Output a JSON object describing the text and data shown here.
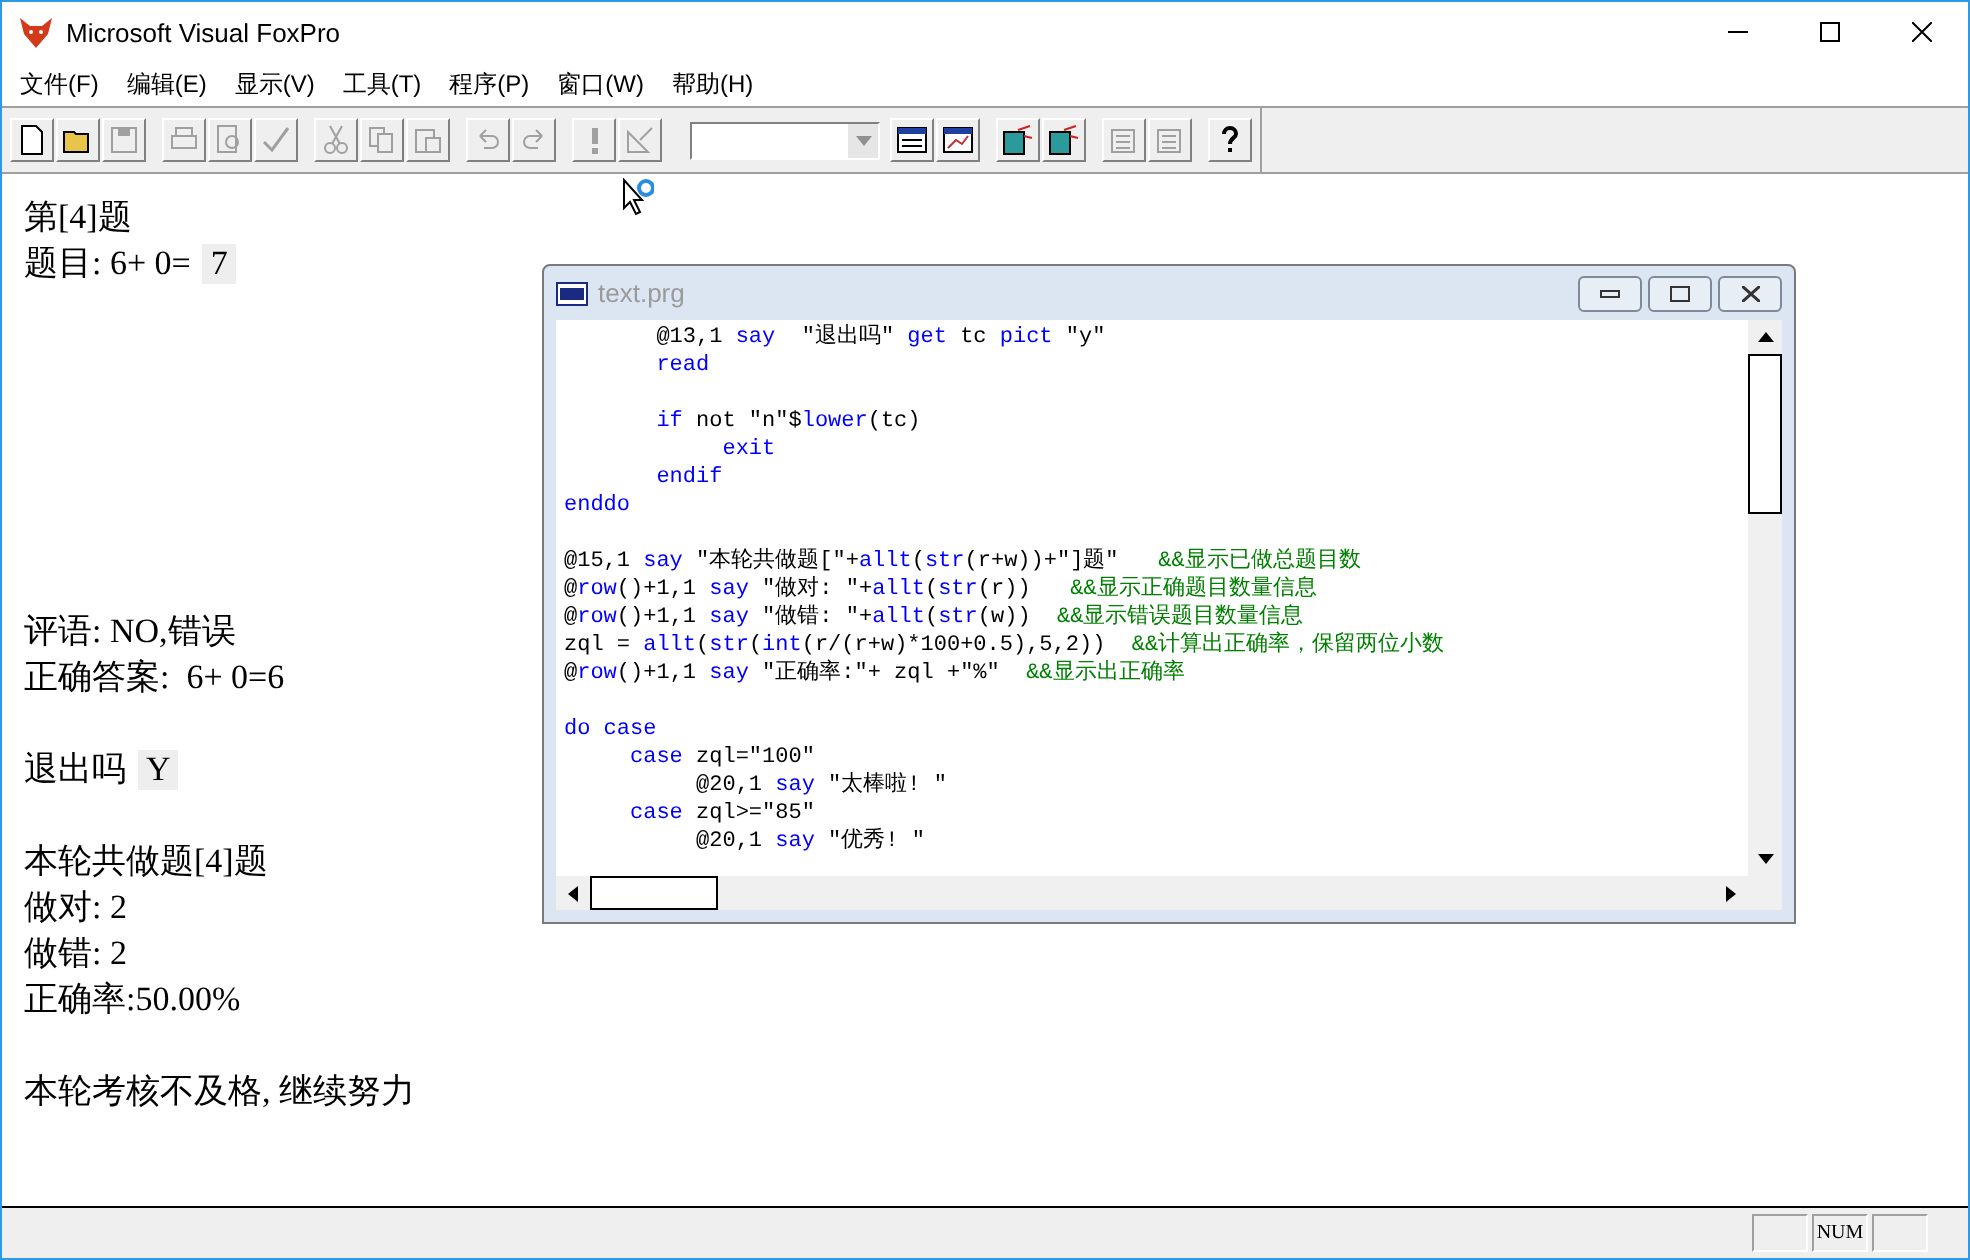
{
  "window": {
    "title": "Microsoft Visual FoxPro"
  },
  "menu": [
    "文件(F)",
    "编辑(E)",
    "显示(V)",
    "工具(T)",
    "程序(P)",
    "窗口(W)",
    "帮助(H)"
  ],
  "toolbar": [
    {
      "kind": "button",
      "disabled": false
    },
    {
      "kind": "button",
      "disabled": false
    },
    {
      "kind": "button",
      "disabled": true
    },
    {
      "kind": "separator"
    },
    {
      "kind": "button",
      "disabled": true
    },
    {
      "kind": "button",
      "disabled": true
    },
    {
      "kind": "button",
      "disabled": true
    },
    {
      "kind": "separator"
    },
    {
      "kind": "button",
      "disabled": true
    },
    {
      "kind": "button",
      "disabled": true
    },
    {
      "kind": "button",
      "disabled": true
    },
    {
      "kind": "separator"
    },
    {
      "kind": "button",
      "disabled": true
    },
    {
      "kind": "button",
      "disabled": true
    },
    {
      "kind": "separator"
    },
    {
      "kind": "button",
      "disabled": true
    },
    {
      "kind": "button",
      "disabled": true
    },
    {
      "kind": "separator"
    },
    {
      "kind": "combo"
    },
    {
      "kind": "button",
      "disabled": false
    },
    {
      "kind": "button",
      "disabled": false
    },
    {
      "kind": "separator"
    },
    {
      "kind": "button",
      "disabled": false
    },
    {
      "kind": "button",
      "disabled": false
    },
    {
      "kind": "separator"
    },
    {
      "kind": "button",
      "disabled": true
    },
    {
      "kind": "button",
      "disabled": true
    },
    {
      "kind": "separator"
    },
    {
      "kind": "button",
      "disabled": false
    }
  ],
  "output": [
    {
      "kind": "text",
      "text": "第[4]题"
    },
    {
      "kind": "text",
      "text": "题目: 6+ 0=",
      "input": "7"
    },
    {
      "kind": "blank"
    },
    {
      "kind": "blank"
    },
    {
      "kind": "blank"
    },
    {
      "kind": "blank"
    },
    {
      "kind": "blank"
    },
    {
      "kind": "blank"
    },
    {
      "kind": "blank"
    },
    {
      "kind": "text",
      "text": "评语: NO,错误"
    },
    {
      "kind": "text",
      "text": "正确答案:  6+ 0=6"
    },
    {
      "kind": "blank"
    },
    {
      "kind": "text",
      "text": "退出吗",
      "input": "Y"
    },
    {
      "kind": "blank"
    },
    {
      "kind": "text",
      "text": "本轮共做题[4]题"
    },
    {
      "kind": "text",
      "text": "做对: 2"
    },
    {
      "kind": "text",
      "text": "做错: 2"
    },
    {
      "kind": "text",
      "text": "正确率:50.00%"
    },
    {
      "kind": "blank"
    },
    {
      "kind": "text",
      "text": "本轮考核不及格, 继续努力"
    }
  ],
  "editor": {
    "title": "text.prg",
    "active": false,
    "lines": [
      {
        "kind": "code",
        "segments": [
          {
            "kind": "plain",
            "text": "       @13,1 "
          },
          {
            "kind": "keyword",
            "text": "say"
          },
          {
            "kind": "plain",
            "text": "  \"退出吗\" "
          },
          {
            "kind": "keyword",
            "text": "get"
          },
          {
            "kind": "plain",
            "text": " tc "
          },
          {
            "kind": "keyword",
            "text": "pict"
          },
          {
            "kind": "plain",
            "text": " \"y\""
          }
        ]
      },
      {
        "kind": "code",
        "segments": [
          {
            "kind": "keyword",
            "text": "       read"
          }
        ]
      },
      {
        "kind": "blank"
      },
      {
        "kind": "code",
        "segments": [
          {
            "kind": "keyword",
            "text": "       if"
          },
          {
            "kind": "plain",
            "text": " not \"n\"$"
          },
          {
            "kind": "keyword",
            "text": "lower"
          },
          {
            "kind": "plain",
            "text": "(tc)"
          }
        ]
      },
      {
        "kind": "code",
        "segments": [
          {
            "kind": "keyword",
            "text": "            exit"
          }
        ]
      },
      {
        "kind": "code",
        "segments": [
          {
            "kind": "keyword",
            "text": "       endif"
          }
        ]
      },
      {
        "kind": "code",
        "segments": [
          {
            "kind": "keyword",
            "text": "enddo"
          }
        ]
      },
      {
        "kind": "blank"
      },
      {
        "kind": "code",
        "segments": [
          {
            "kind": "plain",
            "text": "@15,1 "
          },
          {
            "kind": "keyword",
            "text": "say"
          },
          {
            "kind": "plain",
            "text": " \"本轮共做题[\"+"
          },
          {
            "kind": "keyword",
            "text": "allt"
          },
          {
            "kind": "plain",
            "text": "("
          },
          {
            "kind": "keyword",
            "text": "str"
          },
          {
            "kind": "plain",
            "text": "(r+w))+\"]题\"   "
          },
          {
            "kind": "comment",
            "text": "&&显示已做总题目数"
          }
        ]
      },
      {
        "kind": "code",
        "segments": [
          {
            "kind": "plain",
            "text": "@"
          },
          {
            "kind": "keyword",
            "text": "row"
          },
          {
            "kind": "plain",
            "text": "()+1,1 "
          },
          {
            "kind": "keyword",
            "text": "say"
          },
          {
            "kind": "plain",
            "text": " \"做对: \"+"
          },
          {
            "kind": "keyword",
            "text": "allt"
          },
          {
            "kind": "plain",
            "text": "("
          },
          {
            "kind": "keyword",
            "text": "str"
          },
          {
            "kind": "plain",
            "text": "(r))   "
          },
          {
            "kind": "comment",
            "text": "&&显示正确题目数量信息"
          }
        ]
      },
      {
        "kind": "code",
        "segments": [
          {
            "kind": "plain",
            "text": "@"
          },
          {
            "kind": "keyword",
            "text": "row"
          },
          {
            "kind": "plain",
            "text": "()+1,1 "
          },
          {
            "kind": "keyword",
            "text": "say"
          },
          {
            "kind": "plain",
            "text": " \"做错: \"+"
          },
          {
            "kind": "keyword",
            "text": "allt"
          },
          {
            "kind": "plain",
            "text": "("
          },
          {
            "kind": "keyword",
            "text": "str"
          },
          {
            "kind": "plain",
            "text": "(w))  "
          },
          {
            "kind": "comment",
            "text": "&&显示错误题目数量信息"
          }
        ]
      },
      {
        "kind": "code",
        "segments": [
          {
            "kind": "plain",
            "text": "zql = "
          },
          {
            "kind": "keyword",
            "text": "allt"
          },
          {
            "kind": "plain",
            "text": "("
          },
          {
            "kind": "keyword",
            "text": "str"
          },
          {
            "kind": "plain",
            "text": "("
          },
          {
            "kind": "keyword",
            "text": "int"
          },
          {
            "kind": "plain",
            "text": "(r/(r+w)*100+0.5),5,2))  "
          },
          {
            "kind": "comment",
            "text": "&&计算出正确率，保留两位小数"
          }
        ]
      },
      {
        "kind": "code",
        "segments": [
          {
            "kind": "plain",
            "text": "@"
          },
          {
            "kind": "keyword",
            "text": "row"
          },
          {
            "kind": "plain",
            "text": "()+1,1 "
          },
          {
            "kind": "keyword",
            "text": "say"
          },
          {
            "kind": "plain",
            "text": " \"正确率:\"+ zql +\"%\"  "
          },
          {
            "kind": "comment",
            "text": "&&显示出正确率"
          }
        ]
      },
      {
        "kind": "blank"
      },
      {
        "kind": "code",
        "segments": [
          {
            "kind": "keyword",
            "text": "do case"
          }
        ]
      },
      {
        "kind": "code",
        "segments": [
          {
            "kind": "keyword",
            "text": "     case"
          },
          {
            "kind": "plain",
            "text": " zql=\"100\""
          }
        ]
      },
      {
        "kind": "code",
        "segments": [
          {
            "kind": "plain",
            "text": "          @20,1 "
          },
          {
            "kind": "keyword",
            "text": "say"
          },
          {
            "kind": "plain",
            "text": " \"太棒啦! \""
          }
        ]
      },
      {
        "kind": "code",
        "segments": [
          {
            "kind": "keyword",
            "text": "     case"
          },
          {
            "kind": "plain",
            "text": " zql>=\"85\""
          }
        ]
      },
      {
        "kind": "code",
        "segments": [
          {
            "kind": "plain",
            "text": "          @20,1 "
          },
          {
            "kind": "keyword",
            "text": "say"
          },
          {
            "kind": "plain",
            "text": " \"优秀! \""
          }
        ]
      }
    ]
  },
  "status_bar": {
    "indicators": [
      "NUM"
    ]
  }
}
